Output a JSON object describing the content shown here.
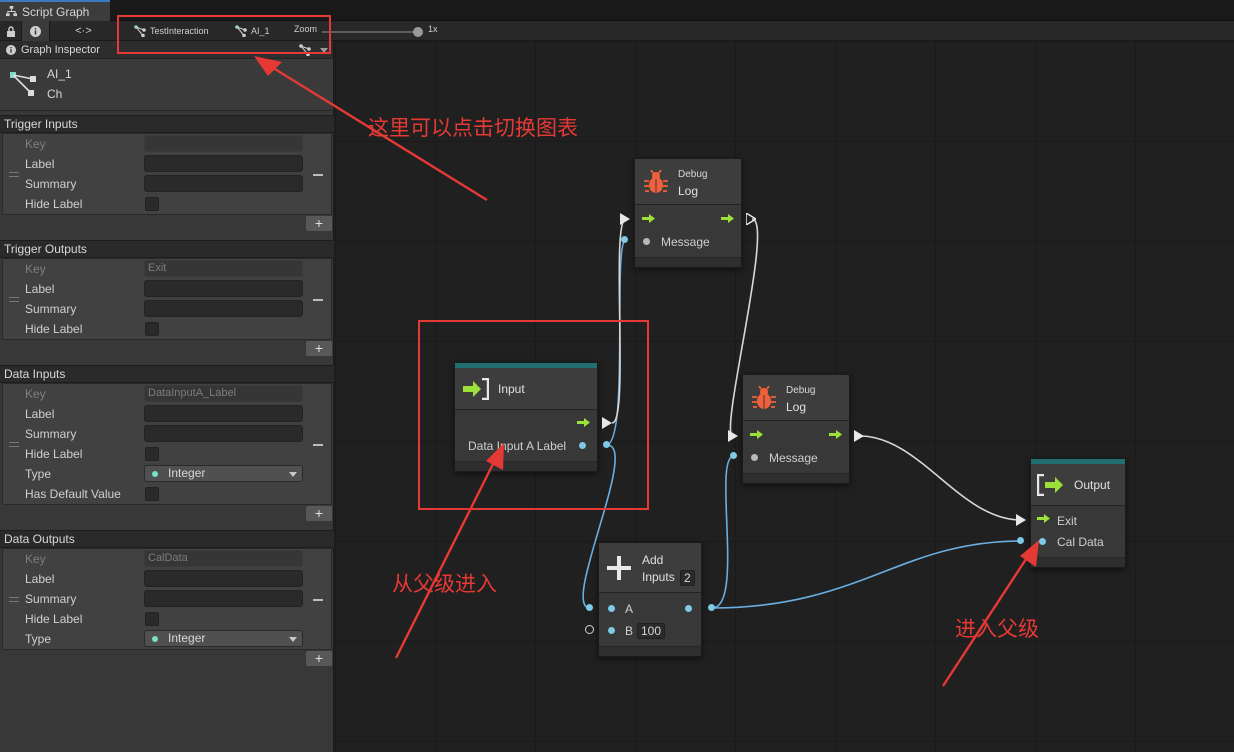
{
  "window": {
    "tab_title": "Script Graph"
  },
  "toolbar": {
    "breadcrumbs": [
      "TestInteraction",
      "AI_1"
    ],
    "zoom_label": "Zoom",
    "zoom_value": "1x",
    "zoom_level": 1.0,
    "code_toggle": "<·>"
  },
  "inspector": {
    "title": "Graph Inspector",
    "graph_name": "AI_1",
    "graph_subtitle": "Ch",
    "sections": [
      {
        "title": "Trigger Inputs",
        "rows": [
          {
            "label": "Key",
            "kind": "field",
            "value": "",
            "disabled": true
          },
          {
            "label": "Label",
            "kind": "field",
            "value": ""
          },
          {
            "label": "Summary",
            "kind": "field",
            "value": ""
          },
          {
            "label": "Hide Label",
            "kind": "checkbox"
          }
        ]
      },
      {
        "title": "Trigger Outputs",
        "rows": [
          {
            "label": "Key",
            "kind": "field",
            "value": "Exit",
            "disabled": true
          },
          {
            "label": "Label",
            "kind": "field",
            "value": ""
          },
          {
            "label": "Summary",
            "kind": "field",
            "value": ""
          },
          {
            "label": "Hide Label",
            "kind": "checkbox"
          }
        ]
      },
      {
        "title": "Data Inputs",
        "rows": [
          {
            "label": "Key",
            "kind": "field",
            "value": "DataInputA_Label",
            "disabled": true
          },
          {
            "label": "Label",
            "kind": "field",
            "value": ""
          },
          {
            "label": "Summary",
            "kind": "field",
            "value": ""
          },
          {
            "label": "Hide Label",
            "kind": "checkbox"
          },
          {
            "label": "Type",
            "kind": "select",
            "value": "Integer"
          },
          {
            "label": "Has Default Value",
            "kind": "checkbox"
          }
        ]
      },
      {
        "title": "Data Outputs",
        "rows": [
          {
            "label": "Key",
            "kind": "field",
            "value": "CalData",
            "disabled": true
          },
          {
            "label": "Label",
            "kind": "field",
            "value": ""
          },
          {
            "label": "Summary",
            "kind": "field",
            "value": ""
          },
          {
            "label": "Hide Label",
            "kind": "checkbox"
          },
          {
            "label": "Type",
            "kind": "select",
            "value": "Integer"
          }
        ]
      }
    ],
    "add_label": "+"
  },
  "nodes": {
    "debug1": {
      "category": "Debug",
      "name": "Log",
      "port": "Message"
    },
    "debug2": {
      "category": "Debug",
      "name": "Log",
      "port": "Message"
    },
    "input": {
      "name": "Input",
      "port": "Data Input A Label"
    },
    "add": {
      "name1": "Add",
      "name2": "Inputs",
      "count": "2",
      "port_a": "A",
      "port_b": "B",
      "b_value": "100"
    },
    "output": {
      "name": "Output",
      "port_exit": "Exit",
      "port_data": "Cal Data"
    }
  },
  "annotations": {
    "switch_graph": "这里可以点击切换图表",
    "enter_from_parent": "从父级进入",
    "enter_parent": "进入父级"
  },
  "colors": {
    "flow_green": "#9be13a",
    "data_blue": "#7ec9e6",
    "annotation_red": "#e53935",
    "teal_header": "#226e6e",
    "debug_orange": "#f0603a"
  }
}
